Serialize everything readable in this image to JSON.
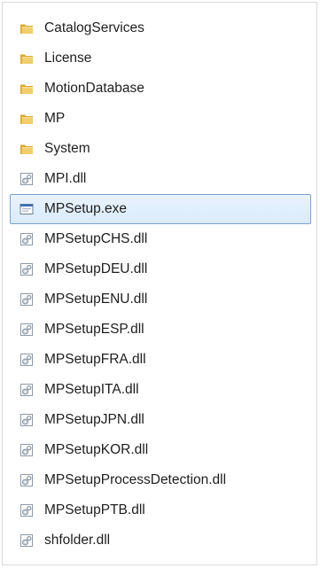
{
  "files": [
    {
      "name": "CatalogServices",
      "type": "folder"
    },
    {
      "name": "License",
      "type": "folder"
    },
    {
      "name": "MotionDatabase",
      "type": "folder"
    },
    {
      "name": "MP",
      "type": "folder"
    },
    {
      "name": "System",
      "type": "folder"
    },
    {
      "name": "MPI.dll",
      "type": "dll"
    },
    {
      "name": "MPSetup.exe",
      "type": "exe",
      "selected": true
    },
    {
      "name": "MPSetupCHS.dll",
      "type": "dll"
    },
    {
      "name": "MPSetupDEU.dll",
      "type": "dll"
    },
    {
      "name": "MPSetupENU.dll",
      "type": "dll"
    },
    {
      "name": "MPSetupESP.dll",
      "type": "dll"
    },
    {
      "name": "MPSetupFRA.dll",
      "type": "dll"
    },
    {
      "name": "MPSetupITA.dll",
      "type": "dll"
    },
    {
      "name": "MPSetupJPN.dll",
      "type": "dll"
    },
    {
      "name": "MPSetupKOR.dll",
      "type": "dll"
    },
    {
      "name": "MPSetupProcessDetection.dll",
      "type": "dll"
    },
    {
      "name": "MPSetupPTB.dll",
      "type": "dll"
    },
    {
      "name": "shfolder.dll",
      "type": "dll"
    }
  ],
  "icons": {
    "folder": "folder-icon",
    "dll": "dll-file-icon",
    "exe": "exe-file-icon"
  },
  "colors": {
    "selection_border": "#7da2ce",
    "selection_fill": "#d9ebfc",
    "folder": "#e8b845"
  }
}
